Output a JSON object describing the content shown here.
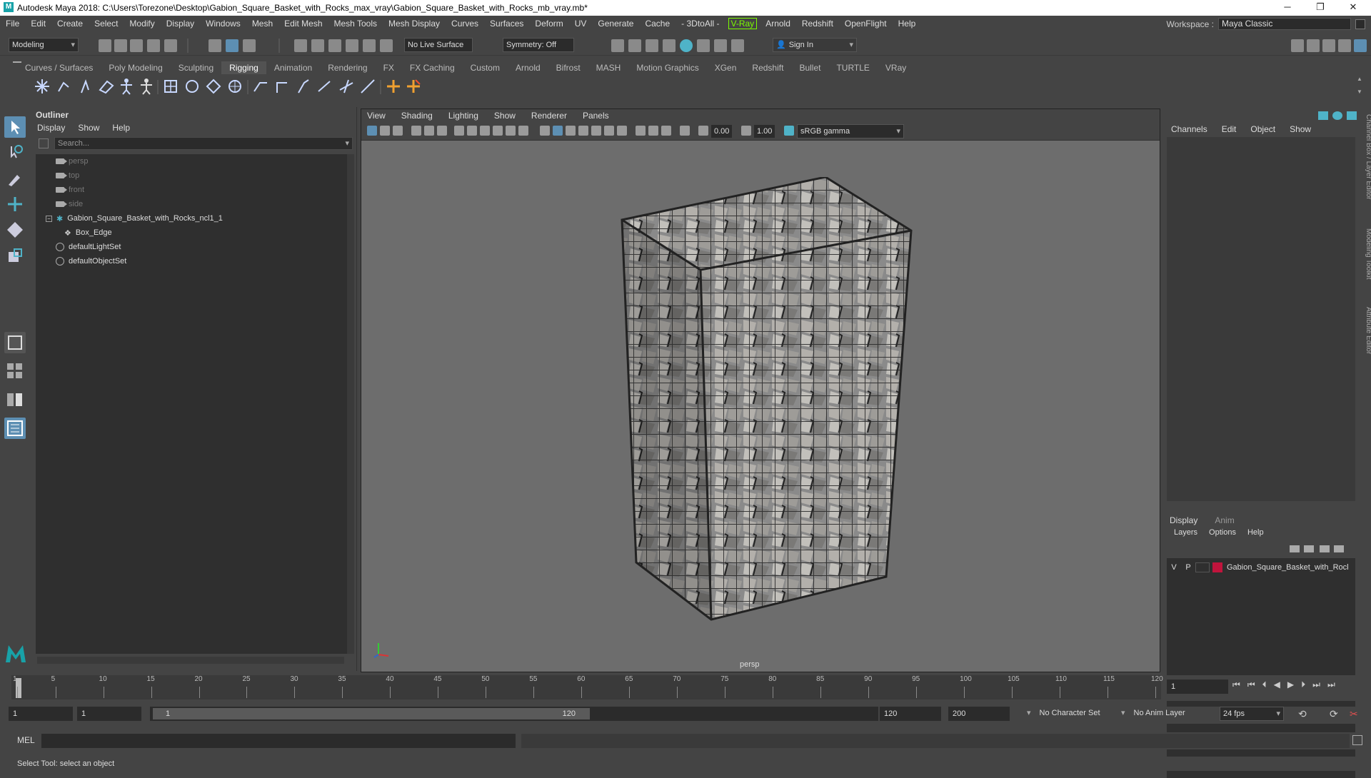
{
  "title": "Autodesk Maya 2018: C:\\Users\\Torezone\\Desktop\\Gabion_Square_Basket_with_Rocks_max_vray\\Gabion_Square_Basket_with_Rocks_mb_vray.mb*",
  "menubar": [
    "File",
    "Edit",
    "Create",
    "Select",
    "Modify",
    "Display",
    "Windows",
    "Mesh",
    "Edit Mesh",
    "Mesh Tools",
    "Mesh Display",
    "Curves",
    "Surfaces",
    "Deform",
    "UV",
    "Generate",
    "Cache",
    "- 3DtoAll -",
    "V-Ray",
    "Arnold",
    "Redshift",
    "OpenFlight",
    "Help"
  ],
  "workspace": {
    "label": "Workspace :",
    "value": "Maya Classic"
  },
  "statusline": {
    "mode": "Modeling",
    "live_surface": "No Live Surface",
    "symmetry": "Symmetry: Off",
    "sign_in": "Sign In"
  },
  "shelf_tabs": [
    "Curves / Surfaces",
    "Poly Modeling",
    "Sculpting",
    "Rigging",
    "Animation",
    "Rendering",
    "FX",
    "FX Caching",
    "Custom",
    "Arnold",
    "Bifrost",
    "MASH",
    "Motion Graphics",
    "XGen",
    "Redshift",
    "Bullet",
    "TURTLE",
    "VRay"
  ],
  "active_shelf": "Rigging",
  "outliner": {
    "title": "Outliner",
    "menu": [
      "Display",
      "Show",
      "Help"
    ],
    "search_placeholder": "Search...",
    "items": [
      {
        "label": "persp",
        "type": "camera"
      },
      {
        "label": "top",
        "type": "camera"
      },
      {
        "label": "front",
        "type": "camera"
      },
      {
        "label": "side",
        "type": "camera"
      },
      {
        "label": "Gabion_Square_Basket_with_Rocks_ncl1_1",
        "type": "group"
      },
      {
        "label": "Box_Edge",
        "type": "mesh"
      },
      {
        "label": "defaultLightSet",
        "type": "set"
      },
      {
        "label": "defaultObjectSet",
        "type": "set"
      }
    ]
  },
  "viewport": {
    "menu": [
      "View",
      "Shading",
      "Lighting",
      "Show",
      "Renderer",
      "Panels"
    ],
    "exposure": "0.00",
    "gamma": "1.00",
    "color_space": "sRGB gamma",
    "camera_label": "persp"
  },
  "channel_box": {
    "menu": [
      "Channels",
      "Edit",
      "Object",
      "Show"
    ],
    "tabs": [
      "Display",
      "Anim"
    ],
    "layer_menu": [
      "Layers",
      "Options",
      "Help"
    ],
    "layer": {
      "v": "V",
      "p": "P",
      "name": "Gabion_Square_Basket_with_Rocks",
      "color": "#c0143c"
    }
  },
  "side_tabs": [
    "Channel Box / Layer Editor",
    "Modeling Toolkit",
    "Attribute Editor"
  ],
  "timeline": {
    "ticks": [
      "1",
      "5",
      "10",
      "15",
      "20",
      "25",
      "30",
      "35",
      "40",
      "45",
      "50",
      "55",
      "60",
      "65",
      "70",
      "75",
      "80",
      "85",
      "90",
      "95",
      "100",
      "105",
      "110",
      "115",
      "120"
    ],
    "current_frame": "1"
  },
  "range": {
    "start": "1",
    "playback_start": "1",
    "slider_start": "1",
    "slider_end": "120",
    "playback_end": "120",
    "end": "200",
    "character_set": "No Character Set",
    "anim_layer": "No Anim Layer",
    "fps": "24 fps"
  },
  "mel_label": "MEL",
  "help_line": "Select Tool: select an object"
}
